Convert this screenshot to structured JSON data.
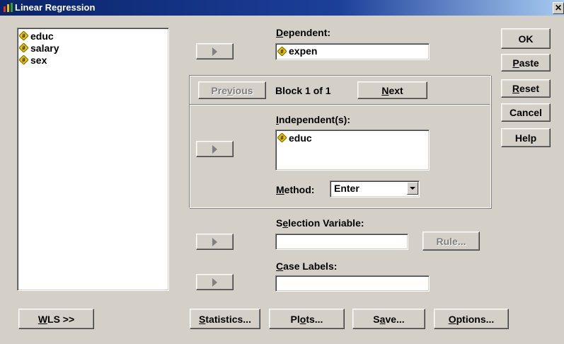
{
  "window": {
    "title": "Linear Regression",
    "close_label": "✕"
  },
  "source_list": {
    "items": [
      "educ",
      "salary",
      "sex"
    ]
  },
  "dependent": {
    "label": "Dependent:",
    "value": "expen"
  },
  "block": {
    "previous_label": "Previous",
    "next_label": "Next",
    "status": "Block 1 of 1"
  },
  "independents": {
    "label": "Independent(s):",
    "items": [
      "educ"
    ]
  },
  "method": {
    "label": "Method:",
    "selected": "Enter"
  },
  "selection_variable": {
    "label": "Selection Variable:",
    "value": "",
    "rule_label": "Rule..."
  },
  "case_labels": {
    "label": "Case Labels:",
    "value": ""
  },
  "side_buttons": {
    "ok": "OK",
    "paste": "Paste",
    "reset": "Reset",
    "cancel": "Cancel",
    "help": "Help"
  },
  "bottom_buttons": {
    "wls": "WLS >>",
    "statistics": "Statistics...",
    "plots": "Plots...",
    "save": "Save...",
    "options": "Options..."
  },
  "colors": {
    "face": "#d4d0c8",
    "title_start": "#0a246a",
    "title_end": "#a6caf0",
    "var_icon": "#e8c800"
  }
}
